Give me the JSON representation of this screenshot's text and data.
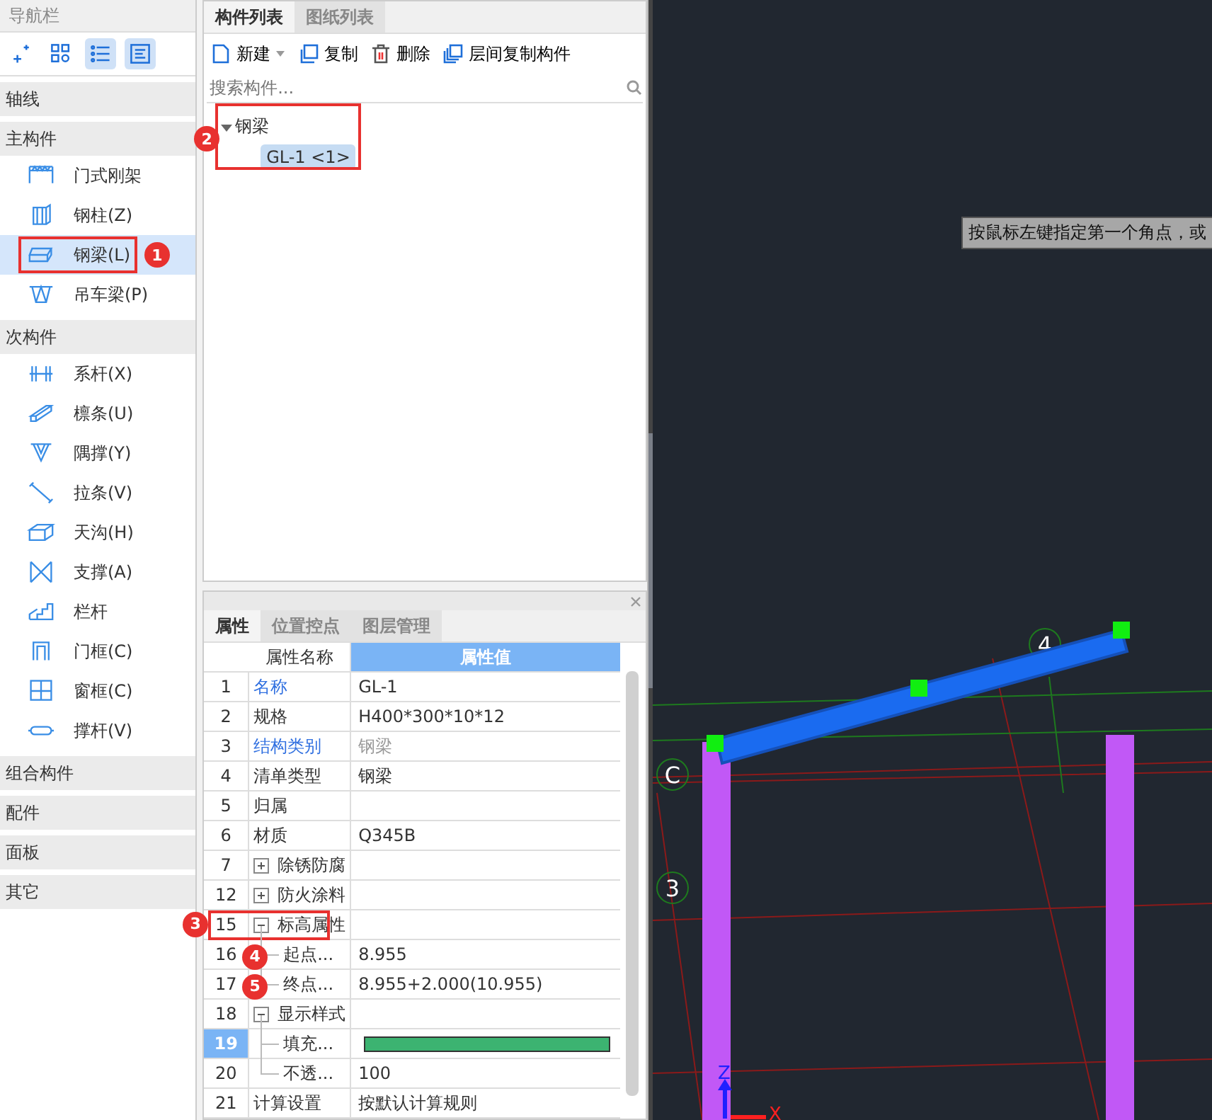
{
  "nav": {
    "title": "导航栏",
    "tools": [
      {
        "selected": false
      },
      {
        "selected": false
      },
      {
        "selected": true
      },
      {
        "selected": true
      }
    ],
    "sections": [
      {
        "label": "轴线"
      },
      {
        "label": "主构件",
        "items": [
          {
            "label": "门式刚架",
            "selected": false
          },
          {
            "label": "钢柱(Z)",
            "selected": false
          },
          {
            "label": "钢梁(L)",
            "selected": true,
            "callout": {
              "label": "1",
              "boxed": true
            }
          },
          {
            "label": "吊车梁(P)",
            "selected": false
          }
        ]
      },
      {
        "label": "次构件",
        "items": [
          {
            "label": "系杆(X)",
            "selected": false
          },
          {
            "label": "檩条(U)",
            "selected": false
          },
          {
            "label": "隅撑(Y)",
            "selected": false
          },
          {
            "label": "拉条(V)",
            "selected": false
          },
          {
            "label": "天沟(H)",
            "selected": false
          },
          {
            "label": "支撑(A)",
            "selected": false
          },
          {
            "label": "栏杆",
            "selected": false
          },
          {
            "label": "门框(C)",
            "selected": false
          },
          {
            "label": "窗框(C)",
            "selected": false
          },
          {
            "label": "撑杆(V)",
            "selected": false
          }
        ]
      },
      {
        "label": "组合构件"
      },
      {
        "label": "配件"
      },
      {
        "label": "面板"
      },
      {
        "label": "其它"
      }
    ]
  },
  "component_panel": {
    "tabs": [
      {
        "label": "构件列表",
        "selected": true
      },
      {
        "label": "图纸列表",
        "selected": false
      }
    ],
    "toolbar": [
      {
        "label": "新建",
        "kind": "new"
      },
      {
        "label": "复制",
        "kind": "copy"
      },
      {
        "label": "删除",
        "kind": "delete"
      },
      {
        "label": "层间复制构件",
        "kind": "floor-copy"
      }
    ],
    "search": {
      "placeholder": "搜索构件..."
    },
    "tree": [
      {
        "label": "钢梁",
        "expanded": true,
        "callout": {
          "label": "2",
          "boxed": true
        },
        "children": [
          {
            "label": "GL-1 <1>",
            "selected": true
          }
        ]
      }
    ]
  },
  "property_panel": {
    "tabs": [
      {
        "label": "属性",
        "selected": true
      },
      {
        "label": "位置控点",
        "selected": false
      },
      {
        "label": "图层管理",
        "selected": false
      }
    ],
    "columns": [
      "属性名称",
      "属性值"
    ],
    "rows": [
      {
        "no": "1",
        "name": "名称",
        "kind": "link",
        "value": "GL-1",
        "selected": false
      },
      {
        "no": "2",
        "name": "规格",
        "kind": "plain",
        "value": "H400*300*10*12",
        "selected": false
      },
      {
        "no": "3",
        "name": "结构类别",
        "kind": "link",
        "value": "钢梁",
        "disabled": true,
        "selected": false
      },
      {
        "no": "4",
        "name": "清单类型",
        "kind": "plain",
        "value": "钢梁",
        "disabled": false,
        "selected": false
      },
      {
        "no": "5",
        "name": "归属",
        "kind": "plain",
        "selected": false
      },
      {
        "no": "6",
        "name": "材质",
        "kind": "plain",
        "value": "Q345B",
        "selected": false
      },
      {
        "no": "7",
        "name": "除锈防腐",
        "kind": "group",
        "expanded": false,
        "selected": false
      },
      {
        "no": "12",
        "name": "防火涂料",
        "kind": "group",
        "expanded": false,
        "selected": false
      },
      {
        "no": "15",
        "name": "标高属性",
        "kind": "group",
        "expanded": true,
        "selected": false,
        "callout": {
          "label": "3",
          "boxed": true
        },
        "children": [
          {
            "no": "16",
            "name": "起点...",
            "kind": "plain",
            "value": "8.955",
            "selected": false,
            "callout": {
              "label": "4"
            }
          },
          {
            "no": "17",
            "name": "终点...",
            "kind": "plain",
            "value": "8.955+2.000(10.955)",
            "selected": false,
            "callout": {
              "label": "5"
            }
          }
        ]
      },
      {
        "no": "18",
        "name": "显示样式",
        "kind": "group",
        "expanded": true,
        "selected": false,
        "children": [
          {
            "no": "19",
            "name": "填充...",
            "kind": "color",
            "color": "#3cb371",
            "selected": true
          },
          {
            "no": "20",
            "name": "不透...",
            "kind": "plain",
            "value": "100",
            "selected": false
          }
        ]
      },
      {
        "no": "21",
        "name": "计算设置",
        "kind": "plain",
        "value": "按默认计算规则",
        "selected": false
      }
    ]
  },
  "canvas": {
    "tooltip": "按鼠标左键指定第一个角点，或",
    "axis_labels": [
      "C",
      "3",
      "4"
    ],
    "gizmo_axes": [
      "Z",
      "X"
    ]
  }
}
